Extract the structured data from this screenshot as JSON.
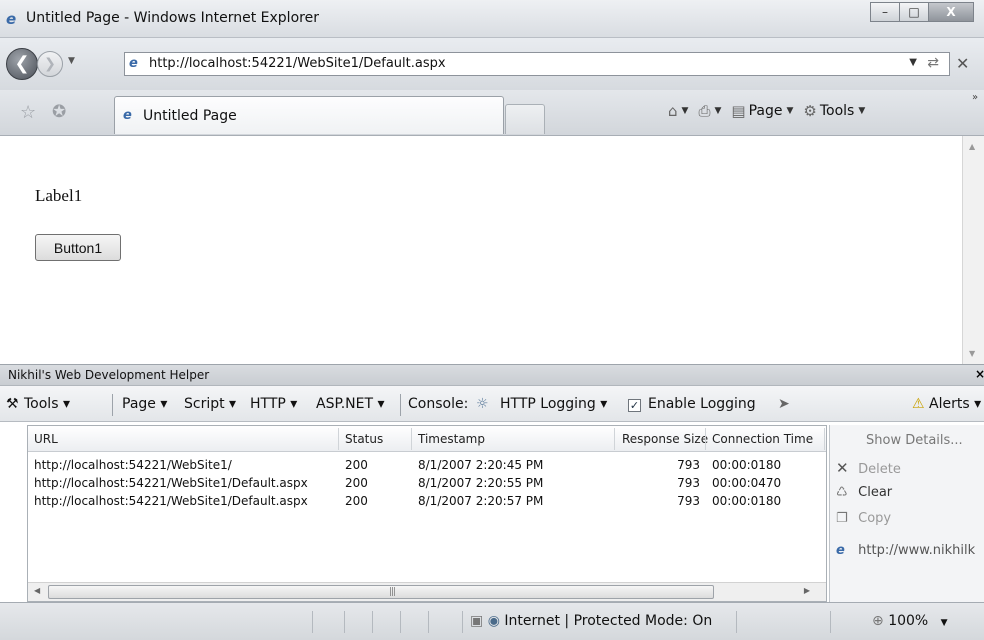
{
  "window": {
    "title": "Untitled Page - Windows Internet Explorer",
    "icons": {
      "app": "ie-logo-icon",
      "minimize": "minimize-icon",
      "maximize": "maximize-icon",
      "close": "close-icon"
    }
  },
  "navigation": {
    "address": "http://localhost:54221/WebSite1/Default.aspx"
  },
  "tabs": {
    "active_label": "Untitled Page"
  },
  "commandbar": {
    "page_label": "Page",
    "tools_label": "Tools"
  },
  "page": {
    "label_text": "Label1",
    "button_text": "Button1"
  },
  "devhelper": {
    "title": "Nikhil's Web Development Helper",
    "toolbar": {
      "tools": "Tools",
      "page": "Page",
      "script": "Script",
      "http": "HTTP",
      "aspnet": "ASP.NET",
      "console": "Console:",
      "http_logging": "HTTP Logging",
      "enable_logging": "Enable Logging",
      "alerts": "Alerts"
    },
    "columns": [
      "URL",
      "Status",
      "Timestamp",
      "Response Size",
      "Connection Time"
    ],
    "rows": [
      {
        "url": "http://localhost:54221/WebSite1/",
        "status": "200",
        "timestamp": "8/1/2007 2:20:45 PM",
        "size": "793",
        "time": "00:00:0180"
      },
      {
        "url": "http://localhost:54221/WebSite1/Default.aspx",
        "status": "200",
        "timestamp": "8/1/2007 2:20:55 PM",
        "size": "793",
        "time": "00:00:0470"
      },
      {
        "url": "http://localhost:54221/WebSite1/Default.aspx",
        "status": "200",
        "timestamp": "8/1/2007 2:20:57 PM",
        "size": "793",
        "time": "00:00:0180"
      }
    ],
    "side": {
      "show_details": "Show Details...",
      "delete": "Delete",
      "clear": "Clear",
      "copy": "Copy",
      "link": "http://www.nikhilk"
    }
  },
  "status": {
    "zone": "Internet | Protected Mode: On",
    "zoom": "100%"
  }
}
